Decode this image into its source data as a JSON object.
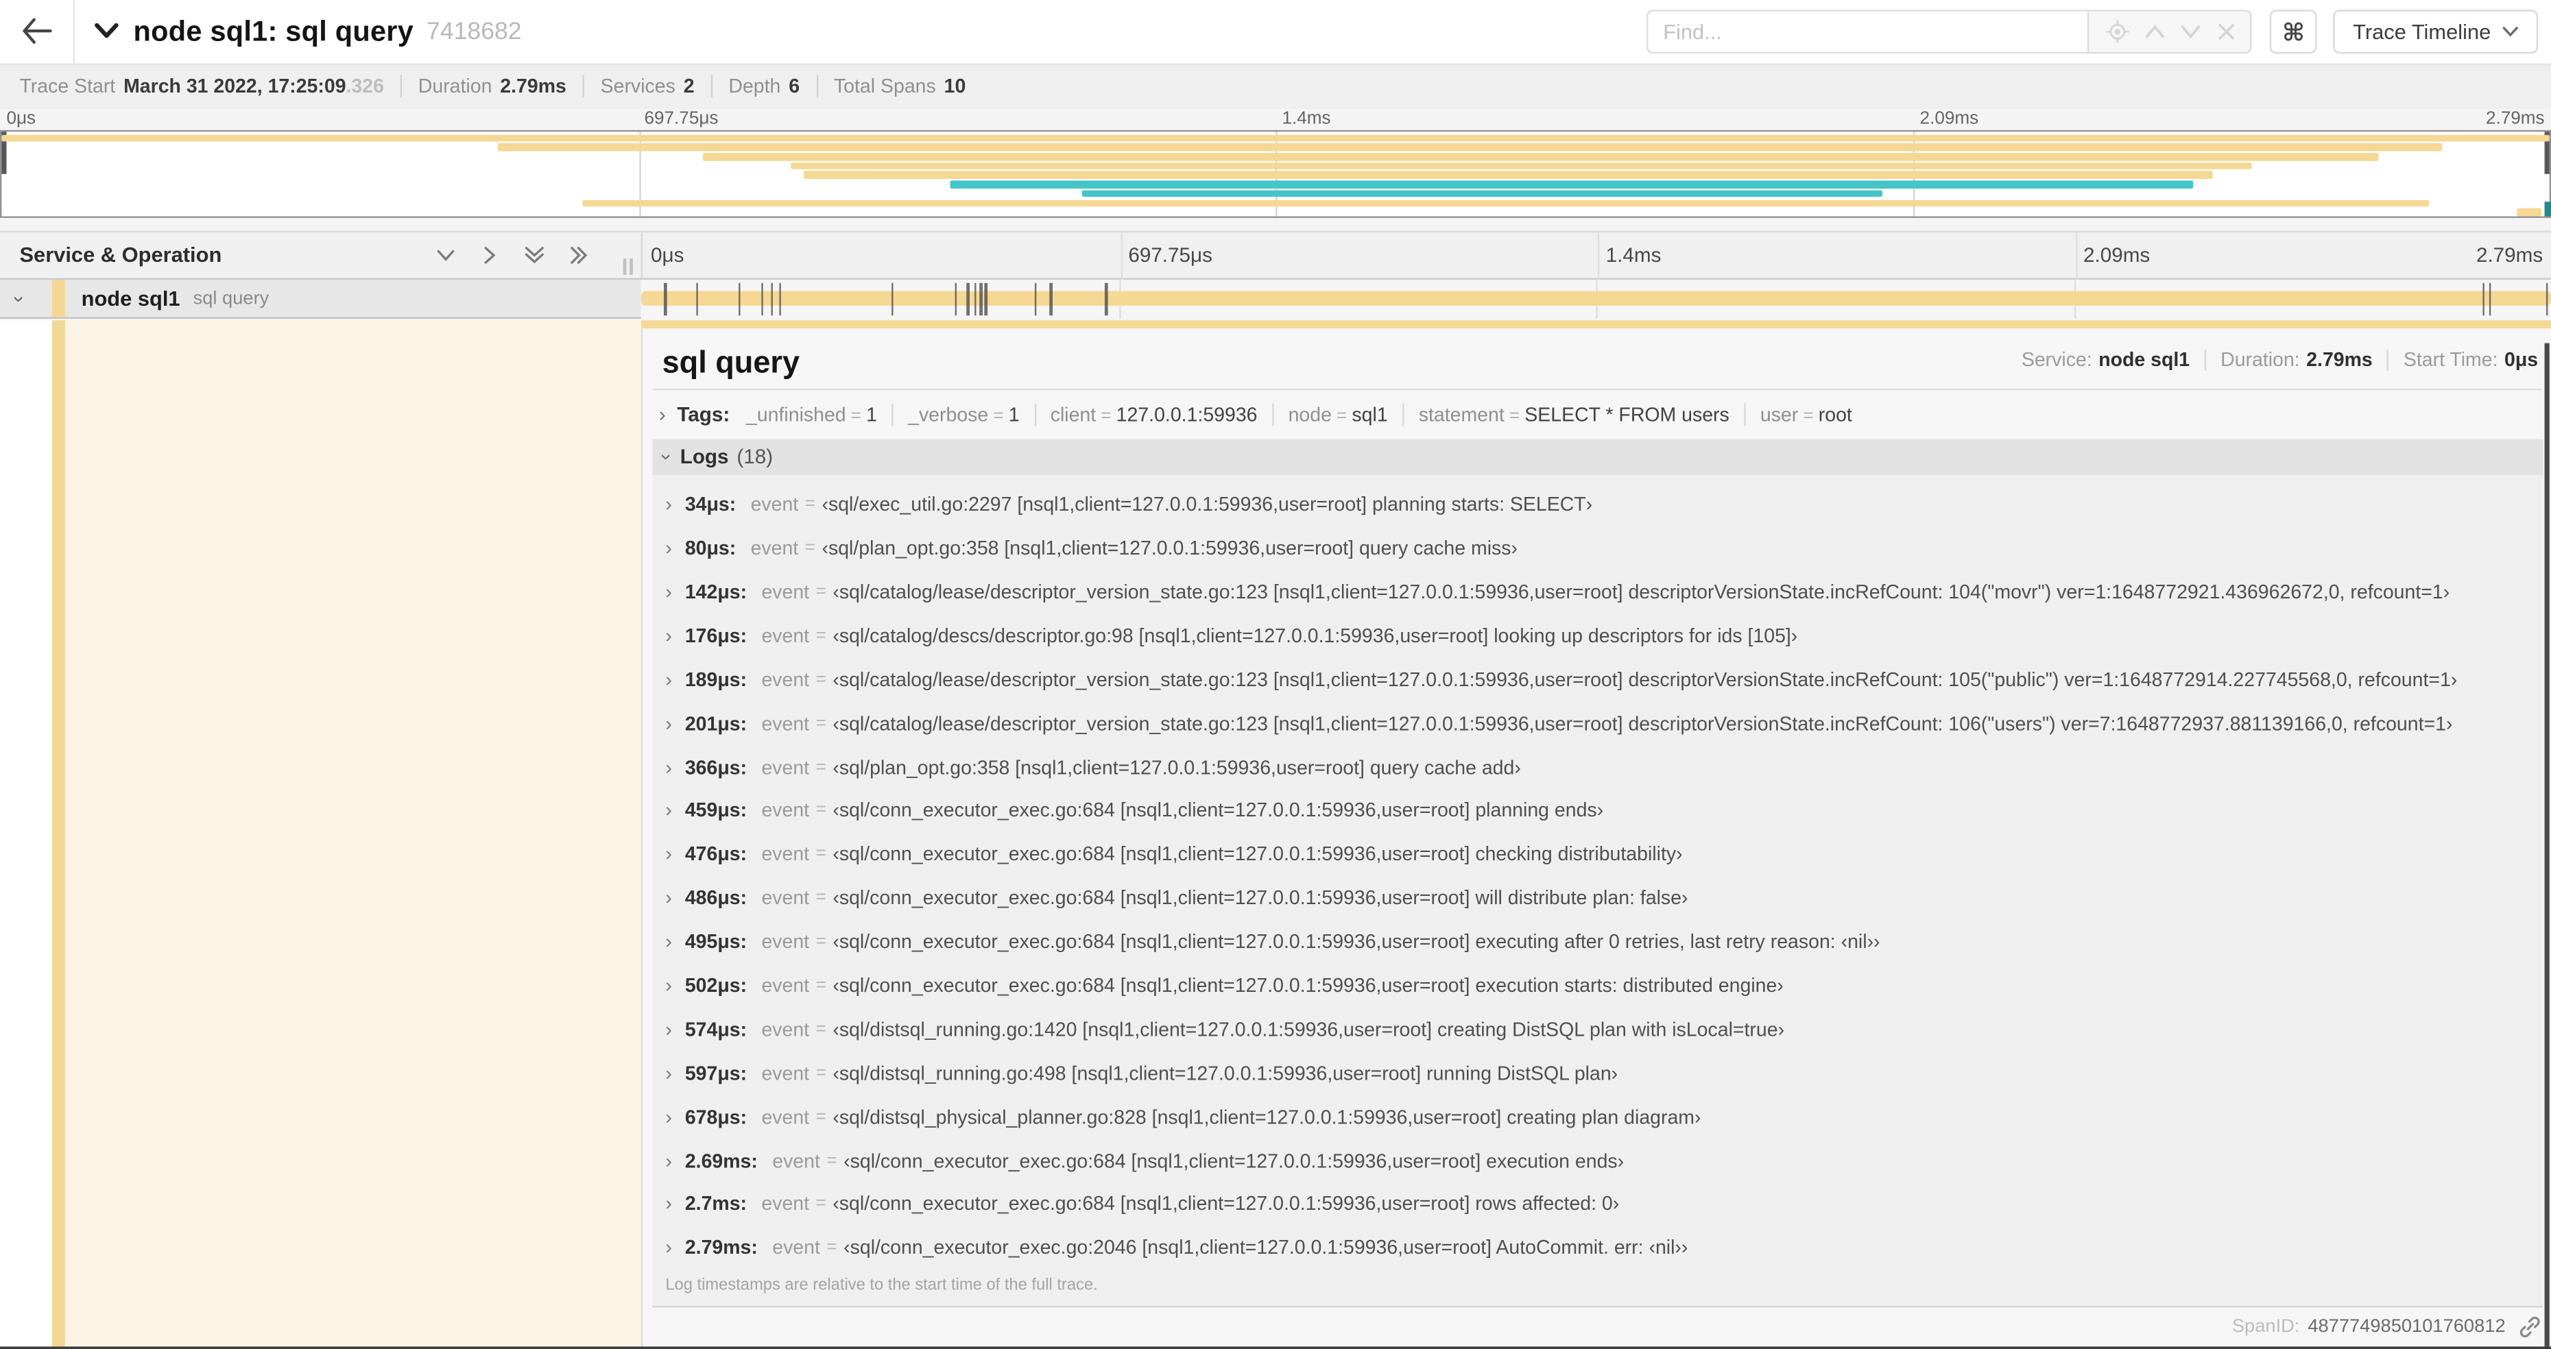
{
  "header": {
    "title": "node sql1: sql query",
    "trace_id": "7418682",
    "shortcut_button": "⌘",
    "view_button": "Trace Timeline"
  },
  "find": {
    "placeholder": "Find..."
  },
  "summary": {
    "items": [
      {
        "label": "Trace Start",
        "value": "March 31 2022, 17:25:09",
        "muted": ".326"
      },
      {
        "label": "Duration",
        "value": "2.79ms",
        "muted": ""
      },
      {
        "label": "Services",
        "value": "2",
        "muted": ""
      },
      {
        "label": "Depth",
        "value": "6",
        "muted": ""
      },
      {
        "label": "Total Spans",
        "value": "10",
        "muted": ""
      }
    ]
  },
  "axis": {
    "ticks": [
      {
        "label": "0μs",
        "pos": 0
      },
      {
        "label": "697.75μs",
        "pos": 25
      },
      {
        "label": "1.4ms",
        "pos": 50
      },
      {
        "label": "2.09ms",
        "pos": 75
      },
      {
        "label": "2.79ms",
        "pos": 100
      }
    ]
  },
  "colors": {
    "tan": "#f5d894",
    "teal": "#45c5c7",
    "cream": "#fcf4e4",
    "stripe": "#f3d795"
  },
  "minimap": {
    "spans": [
      {
        "start": 0,
        "end": 100,
        "color": "tan"
      },
      {
        "start": 19.5,
        "end": 95.8,
        "color": "tan"
      },
      {
        "start": 27.5,
        "end": 93.3,
        "color": "tan"
      },
      {
        "start": 31.0,
        "end": 88.3,
        "color": "tan"
      },
      {
        "start": 31.5,
        "end": 86.8,
        "color": "tan"
      },
      {
        "start": 37.2,
        "end": 86.0,
        "color": "teal"
      },
      {
        "start": 42.4,
        "end": 73.8,
        "color": "teal"
      },
      {
        "start": 22.8,
        "end": 95.3,
        "color": "tan"
      },
      {
        "start": 98.7,
        "end": 99.7,
        "color": "tan"
      }
    ]
  },
  "tree": {
    "header": "Service & Operation",
    "row": {
      "service": "node sql1",
      "operation": "sql query"
    }
  },
  "span": {
    "duration_us": 2790
  },
  "detail": {
    "title": "sql query",
    "meta": [
      {
        "label": "Service:",
        "value": "node sql1"
      },
      {
        "label": "Duration:",
        "value": "2.79ms"
      },
      {
        "label": "Start Time:",
        "value": "0μs"
      }
    ],
    "tags_label": "Tags:",
    "tags": [
      {
        "key": "_unfinished",
        "value": "1"
      },
      {
        "key": "_verbose",
        "value": "1"
      },
      {
        "key": "client",
        "value": "127.0.0.1:59936"
      },
      {
        "key": "node",
        "value": "sql1"
      },
      {
        "key": "statement",
        "value": "SELECT * FROM users"
      },
      {
        "key": "user",
        "value": "root"
      }
    ],
    "logs_label": "Logs",
    "logs_count": "(18)",
    "log_field": "event",
    "logs": [
      {
        "t": "34μs:",
        "us": 34,
        "value": "‹sql/exec_util.go:2297 [nsql1,client=127.0.0.1:59936,user=root] planning starts: SELECT›"
      },
      {
        "t": "80μs:",
        "us": 80,
        "value": "‹sql/plan_opt.go:358 [nsql1,client=127.0.0.1:59936,user=root] query cache miss›"
      },
      {
        "t": "142μs:",
        "us": 142,
        "value": "‹sql/catalog/lease/descriptor_version_state.go:123 [nsql1,client=127.0.0.1:59936,user=root] descriptorVersionState.incRefCount: 104(\"movr\") ver=1:1648772921.436962672,0, refcount=1›"
      },
      {
        "t": "176μs:",
        "us": 176,
        "value": "‹sql/catalog/descs/descriptor.go:98 [nsql1,client=127.0.0.1:59936,user=root] looking up descriptors for ids [105]›"
      },
      {
        "t": "189μs:",
        "us": 189,
        "value": "‹sql/catalog/lease/descriptor_version_state.go:123 [nsql1,client=127.0.0.1:59936,user=root] descriptorVersionState.incRefCount: 105(\"public\") ver=1:1648772914.227745568,0, refcount=1›"
      },
      {
        "t": "201μs:",
        "us": 201,
        "value": "‹sql/catalog/lease/descriptor_version_state.go:123 [nsql1,client=127.0.0.1:59936,user=root] descriptorVersionState.incRefCount: 106(\"users\") ver=7:1648772937.881139166,0, refcount=1›"
      },
      {
        "t": "366μs:",
        "us": 366,
        "value": "‹sql/plan_opt.go:358 [nsql1,client=127.0.0.1:59936,user=root] query cache add›"
      },
      {
        "t": "459μs:",
        "us": 459,
        "value": "‹sql/conn_executor_exec.go:684 [nsql1,client=127.0.0.1:59936,user=root] planning ends›"
      },
      {
        "t": "476μs:",
        "us": 476,
        "value": "‹sql/conn_executor_exec.go:684 [nsql1,client=127.0.0.1:59936,user=root] checking distributability›"
      },
      {
        "t": "486μs:",
        "us": 486,
        "value": "‹sql/conn_executor_exec.go:684 [nsql1,client=127.0.0.1:59936,user=root] will distribute plan: false›"
      },
      {
        "t": "495μs:",
        "us": 495,
        "value": "‹sql/conn_executor_exec.go:684 [nsql1,client=127.0.0.1:59936,user=root] executing after 0 retries, last retry reason: ‹nil››"
      },
      {
        "t": "502μs:",
        "us": 502,
        "value": "‹sql/conn_executor_exec.go:684 [nsql1,client=127.0.0.1:59936,user=root] execution starts: distributed engine›"
      },
      {
        "t": "574μs:",
        "us": 574,
        "value": "‹sql/distsql_running.go:1420 [nsql1,client=127.0.0.1:59936,user=root] creating DistSQL plan with isLocal=true›"
      },
      {
        "t": "597μs:",
        "us": 597,
        "value": "‹sql/distsql_running.go:498 [nsql1,client=127.0.0.1:59936,user=root] running DistSQL plan›"
      },
      {
        "t": "678μs:",
        "us": 678,
        "value": "‹sql/distsql_physical_planner.go:828 [nsql1,client=127.0.0.1:59936,user=root] creating plan diagram›"
      },
      {
        "t": "2.69ms:",
        "us": 2690,
        "value": "‹sql/conn_executor_exec.go:684 [nsql1,client=127.0.0.1:59936,user=root] execution ends›"
      },
      {
        "t": "2.7ms:",
        "us": 2700,
        "value": "‹sql/conn_executor_exec.go:684 [nsql1,client=127.0.0.1:59936,user=root] rows affected: 0›"
      },
      {
        "t": "2.79ms:",
        "us": 2790,
        "value": "‹sql/conn_executor_exec.go:2046 [nsql1,client=127.0.0.1:59936,user=root] AutoCommit. err: ‹nil››"
      }
    ],
    "footer_note": "Log timestamps are relative to the start time of the full trace.",
    "span_id_label": "SpanID:",
    "span_id": "4877749850101760812"
  }
}
